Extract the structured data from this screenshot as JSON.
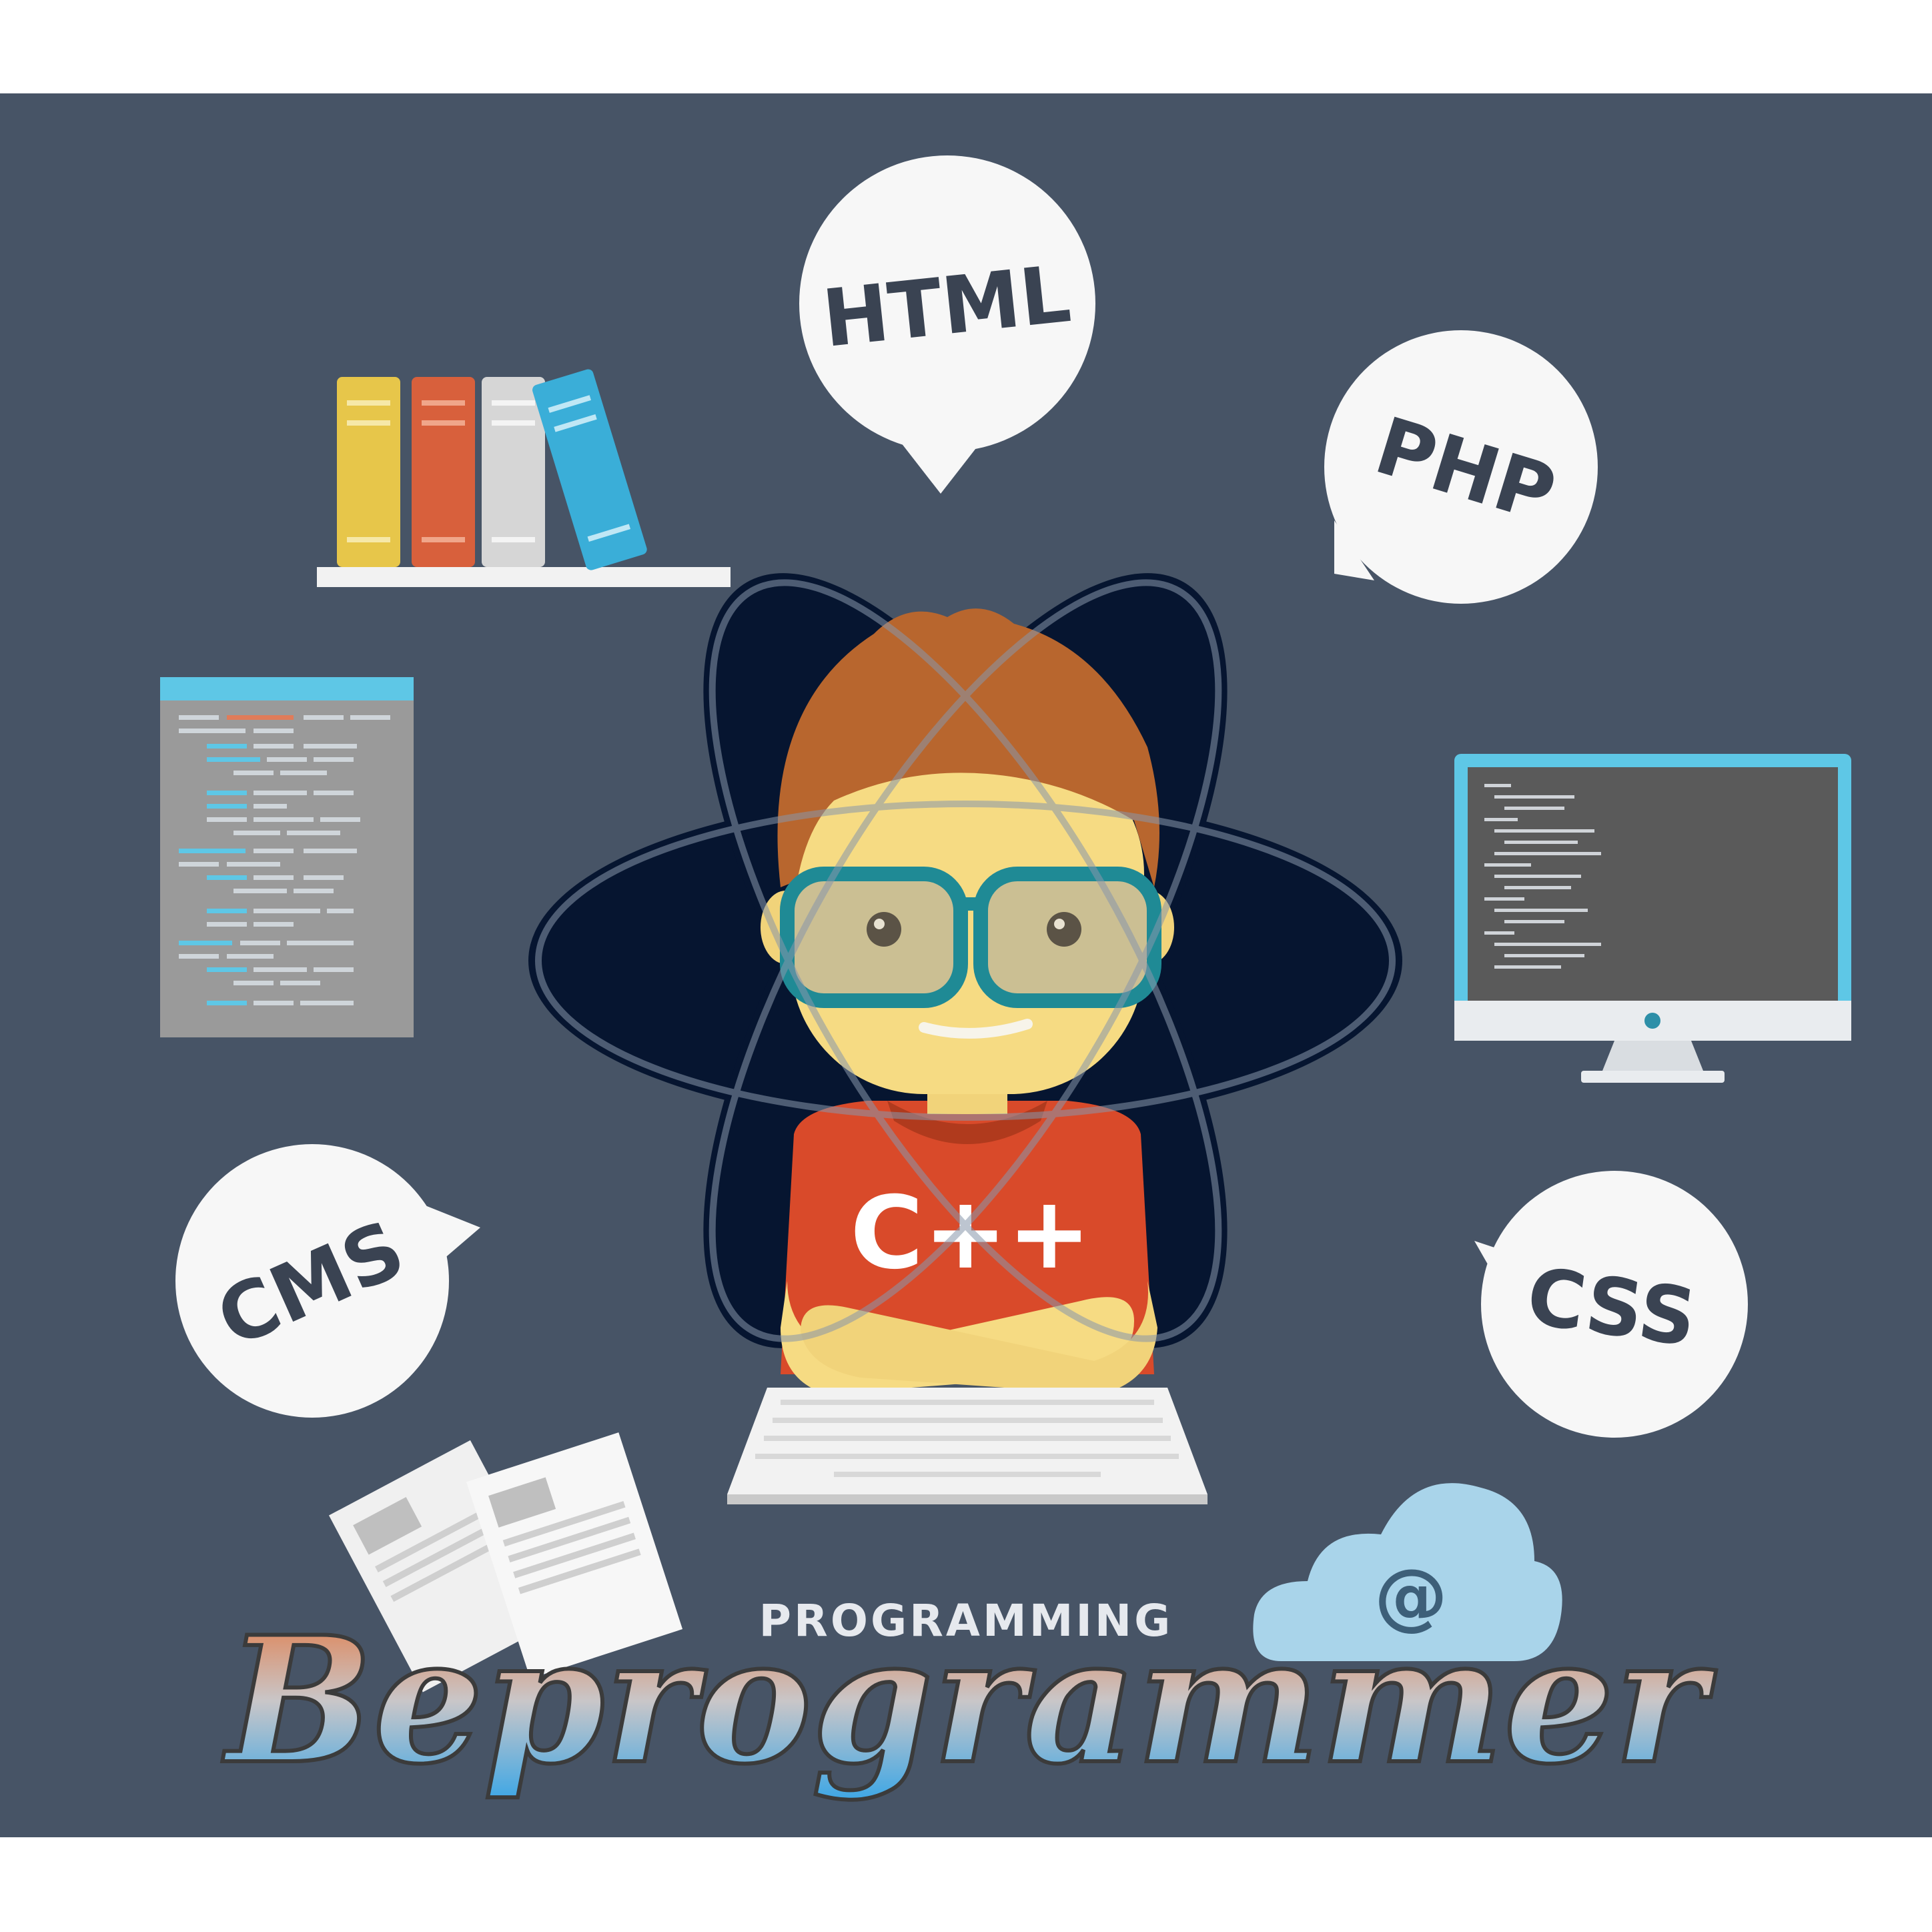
{
  "bubbles": {
    "html": "HTML",
    "php": "PHP",
    "cms": "CMS",
    "css": "CSS"
  },
  "shirt_label": "C++",
  "cloud_symbol": "@",
  "brand": {
    "subtitle": "PROGRAMMING",
    "title": "Beprogrammer"
  },
  "colors": {
    "background": "#475466",
    "atom_dark": "#061530",
    "bubble": "#f7f7f7",
    "shirt": "#d94a2a",
    "glasses": "#1f8a95",
    "hair": "#b8662e",
    "book_yellow": "#e7c64a",
    "book_orange": "#d8603c",
    "book_gray": "#d6d6d6",
    "book_blue": "#3aaed8",
    "cloud": "#a9d4ea"
  }
}
